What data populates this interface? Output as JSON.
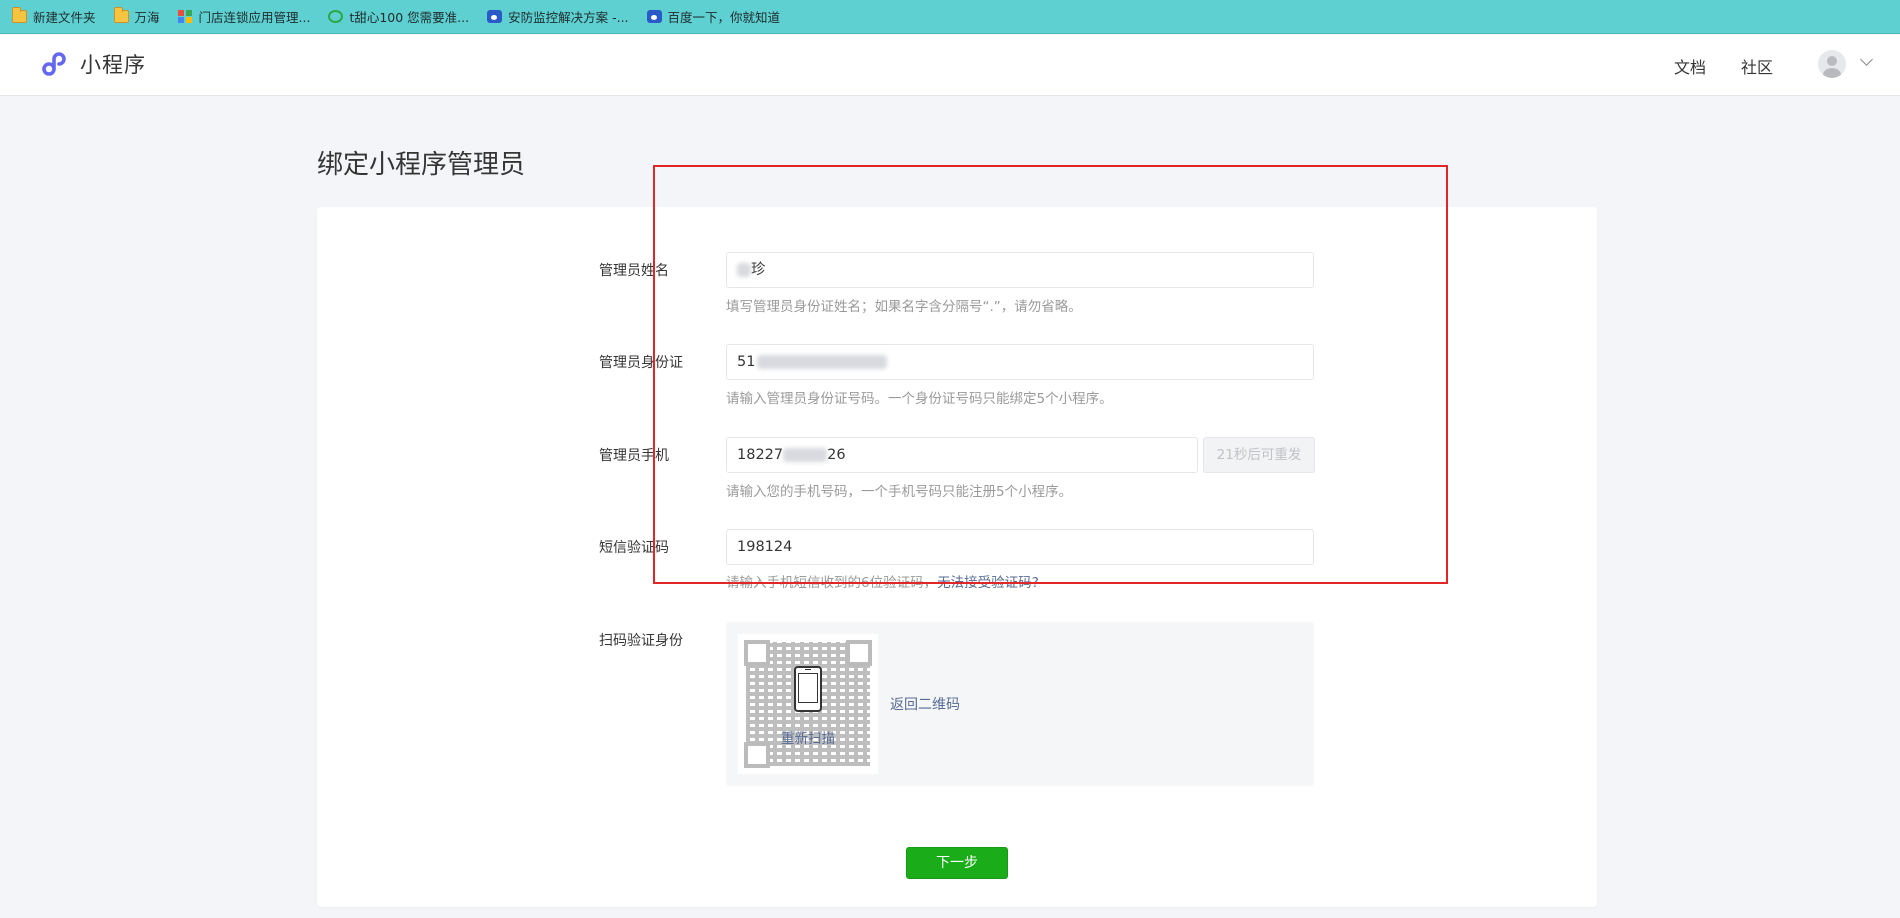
{
  "bookmarks": [
    {
      "label": "新建文件夹",
      "icon": "folder-icon"
    },
    {
      "label": "万海",
      "icon": "folder-icon"
    },
    {
      "label": "门店连锁应用管理...",
      "icon": "grid-icon"
    },
    {
      "label": "t甜心100 您需要准...",
      "icon": "leaf-icon"
    },
    {
      "label": "安防监控解决方案 -...",
      "icon": "paw-icon"
    },
    {
      "label": "百度一下，你就知道",
      "icon": "paw-icon"
    }
  ],
  "header": {
    "logo_text": "小程序",
    "nav": {
      "docs": "文档",
      "community": "社区"
    }
  },
  "page": {
    "title": "绑定小程序管理员"
  },
  "form": {
    "name": {
      "label": "管理员姓名",
      "value_visible": "珍",
      "hint": "填写管理员身份证姓名；如果名字含分隔号“.”，请勿省略。"
    },
    "id_card": {
      "label": "管理员身份证",
      "value_visible": "51",
      "hint": "请输入管理员身份证号码。一个身份证号码只能绑定5个小程序。"
    },
    "phone": {
      "label": "管理员手机",
      "value_prefix": "18227",
      "value_suffix": "26",
      "resend_label": "21秒后可重发",
      "hint": "请输入您的手机号码，一个手机号码只能注册5个小程序。"
    },
    "sms": {
      "label": "短信验证码",
      "value": "198124",
      "hint": "请输入手机短信收到的6位验证码，",
      "hint_link": "无法接受验证码?"
    },
    "scan": {
      "label": "扫码验证身份",
      "rescan_label": "重新扫描",
      "back_label": "返回二维码"
    }
  },
  "actions": {
    "next_label": "下一步"
  },
  "colors": {
    "accent_green": "#1aad19",
    "link_blue": "#576b95",
    "highlight_red": "#e02626",
    "bookmark_bar": "#5ed0d2"
  }
}
